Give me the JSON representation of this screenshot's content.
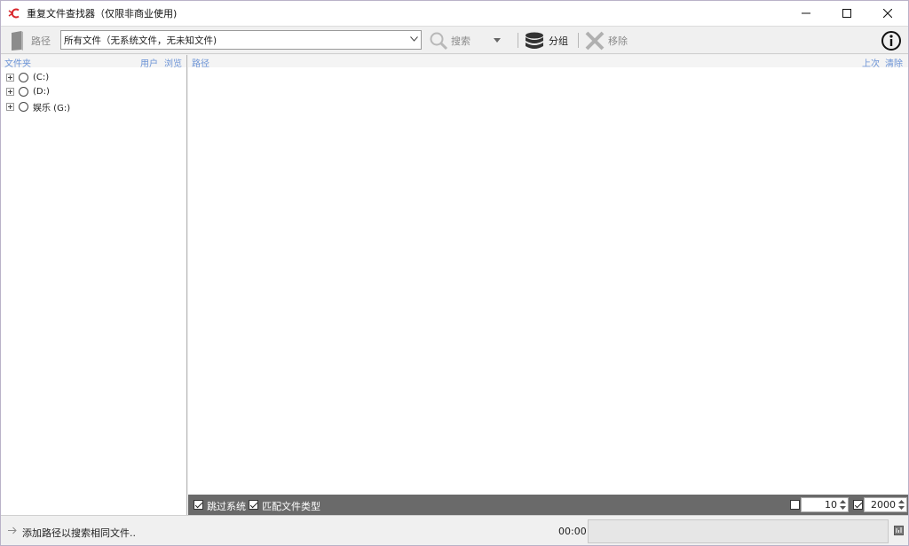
{
  "window": {
    "title": "重复文件查找器（仅限非商业使用)"
  },
  "toolbar": {
    "path_label": "路径",
    "filter_value": "所有文件（无系统文件，无未知文件)",
    "search_label": "搜索",
    "group_label": "分组",
    "remove_label": "移除"
  },
  "left_pane": {
    "header_title": "文件夹",
    "user_link": "用户",
    "browse_link": "浏览",
    "drives": [
      {
        "label": "(C:)"
      },
      {
        "label": "(D:)"
      },
      {
        "label": "娱乐 (G:)"
      }
    ]
  },
  "right_pane": {
    "header_title": "路径",
    "prev_link": "上次",
    "clear_link": "清除"
  },
  "options": {
    "skip_system_label": "跳过系统",
    "skip_system_checked": true,
    "match_type_label": "匹配文件类型",
    "match_type_checked": true,
    "limit1_checked": false,
    "limit1_value": "10",
    "limit2_checked": true,
    "limit2_value": "2000"
  },
  "status": {
    "message": "添加路径以搜索相同文件..",
    "elapsed": "00:00",
    "progress": 0
  },
  "colors": {
    "accent_link": "#6b93d6",
    "options_bar": "#6a6a6a",
    "app_icon": "#d9262b"
  }
}
